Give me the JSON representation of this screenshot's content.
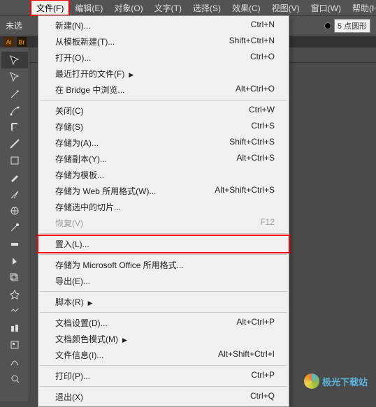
{
  "menubar": [
    {
      "label": "文件(F)",
      "active": true,
      "highlighted": true
    },
    {
      "label": "编辑(E)"
    },
    {
      "label": "对象(O)"
    },
    {
      "label": "文字(T)"
    },
    {
      "label": "选择(S)"
    },
    {
      "label": "效果(C)"
    },
    {
      "label": "视图(V)"
    },
    {
      "label": "窗口(W)"
    },
    {
      "label": "帮助(H)"
    }
  ],
  "controlbar": {
    "unselect": "未选",
    "stroke_label": "5 点圆形"
  },
  "dropdown": [
    {
      "type": "item",
      "label": "新建(N)...",
      "short": "Ctrl+N"
    },
    {
      "type": "item",
      "label": "从模板新建(T)...",
      "short": "Shift+Ctrl+N"
    },
    {
      "type": "item",
      "label": "打开(O)...",
      "short": "Ctrl+O"
    },
    {
      "type": "item",
      "label": "最近打开的文件(F)",
      "short": "",
      "arrow": true
    },
    {
      "type": "item",
      "label": "在 Bridge 中浏览...",
      "short": "Alt+Ctrl+O"
    },
    {
      "type": "sep"
    },
    {
      "type": "item",
      "label": "关闭(C)",
      "short": "Ctrl+W"
    },
    {
      "type": "item",
      "label": "存储(S)",
      "short": "Ctrl+S"
    },
    {
      "type": "item",
      "label": "存储为(A)...",
      "short": "Shift+Ctrl+S"
    },
    {
      "type": "item",
      "label": "存储副本(Y)...",
      "short": "Alt+Ctrl+S"
    },
    {
      "type": "item",
      "label": "存储为模板...",
      "short": ""
    },
    {
      "type": "item",
      "label": "存储为 Web 所用格式(W)...",
      "short": "Alt+Shift+Ctrl+S"
    },
    {
      "type": "item",
      "label": "存储选中的切片...",
      "short": ""
    },
    {
      "type": "item",
      "label": "恢复(V)",
      "short": "F12",
      "disabled": true
    },
    {
      "type": "sep"
    },
    {
      "type": "item",
      "label": "置入(L)...",
      "short": "",
      "highlighted": true
    },
    {
      "type": "sep"
    },
    {
      "type": "item",
      "label": "存储为 Microsoft Office 所用格式...",
      "short": ""
    },
    {
      "type": "item",
      "label": "导出(E)...",
      "short": ""
    },
    {
      "type": "sep"
    },
    {
      "type": "item",
      "label": "脚本(R)",
      "short": "",
      "arrow": true
    },
    {
      "type": "sep"
    },
    {
      "type": "item",
      "label": "文档设置(D)...",
      "short": "Alt+Ctrl+P"
    },
    {
      "type": "item",
      "label": "文档颜色模式(M)",
      "short": "",
      "arrow": true
    },
    {
      "type": "item",
      "label": "文件信息(I)...",
      "short": "Alt+Shift+Ctrl+I"
    },
    {
      "type": "sep"
    },
    {
      "type": "item",
      "label": "打印(P)...",
      "short": "Ctrl+P"
    },
    {
      "type": "sep"
    },
    {
      "type": "item",
      "label": "退出(X)",
      "short": "Ctrl+Q"
    }
  ],
  "watermark": "极光下载站"
}
